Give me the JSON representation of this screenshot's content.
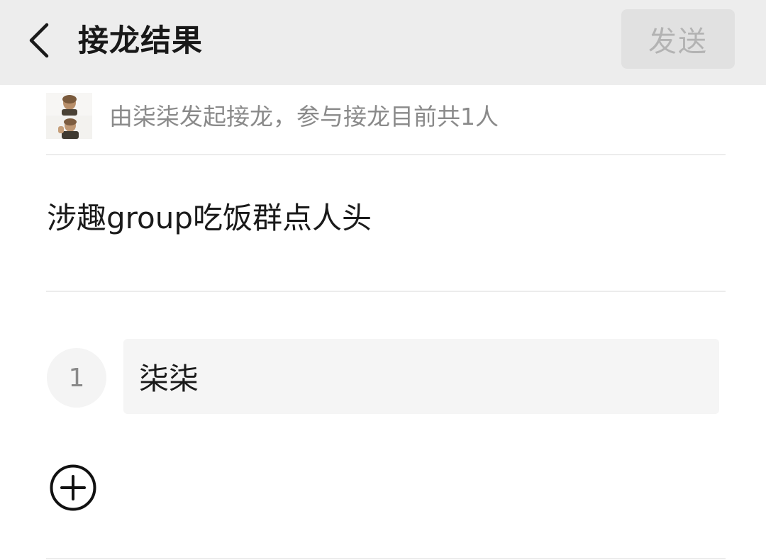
{
  "header": {
    "back_icon": "chevron-left-icon",
    "title": "接龙结果",
    "send_label": "发送"
  },
  "initiator": {
    "avatar": "avatar-image",
    "text": "由柒柒发起接龙，参与接龙目前共1人"
  },
  "topic": {
    "text": "涉趣group吃饭群点人头"
  },
  "entries": [
    {
      "index": "1",
      "name": "柒柒"
    }
  ],
  "add_entry": {
    "icon": "plus-circle-icon"
  },
  "colors": {
    "navbar_bg": "#ededed",
    "send_disabled_bg": "#e1e1e1",
    "send_disabled_text": "#b3b3b3",
    "secondary_text": "#8a8a8a",
    "field_bg": "#f5f5f5"
  }
}
